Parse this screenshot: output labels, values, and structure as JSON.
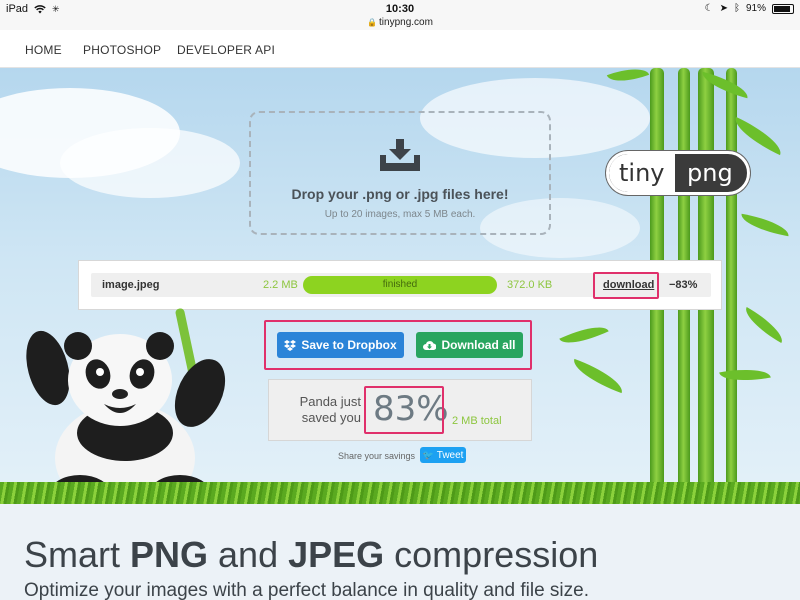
{
  "status_bar": {
    "device": "iPad",
    "time": "10:30",
    "url": "tinypng.com",
    "battery": "91%",
    "battery_level": 0.91
  },
  "nav": {
    "items": [
      "HOME",
      "PHOTOSHOP",
      "DEVELOPER API"
    ]
  },
  "dropzone": {
    "title": "Drop your .png or .jpg files here!",
    "subtitle": "Up to 20 images, max 5 MB each."
  },
  "logo": {
    "left": "tiny",
    "right": "png"
  },
  "result": {
    "filename": "image.jpeg",
    "original_size": "2.2 MB",
    "status": "finished",
    "progress": 1.0,
    "compressed_size": "372.0 KB",
    "download_label": "download",
    "reduction": "−83%"
  },
  "actions": {
    "dropbox_label": "Save to Dropbox",
    "download_all_label": "Download all"
  },
  "summary": {
    "label": "Panda just saved you",
    "percent": "83%",
    "total": "2 MB total"
  },
  "share": {
    "label": "Share your savings",
    "tweet_label": "Tweet"
  },
  "bottom": {
    "heading_pre": "Smart ",
    "heading_png": "PNG",
    "heading_mid": " and ",
    "heading_jpeg": "JPEG",
    "heading_post": " compression",
    "subheading": "Optimize your images with a perfect balance in quality and file size."
  },
  "colors": {
    "accent_green": "#8dd320",
    "dropbox_blue": "#2a84d8",
    "download_green": "#28a55f",
    "highlight": "#e0306b"
  }
}
